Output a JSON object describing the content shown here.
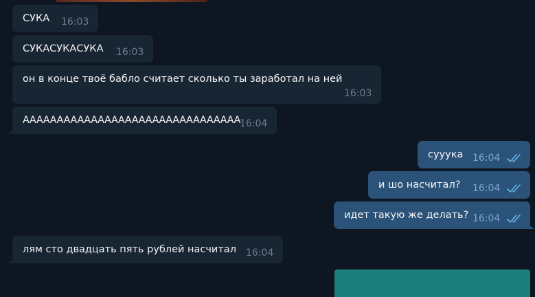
{
  "chat": {
    "messages": [
      {
        "text": "СУКА",
        "time": "16:03"
      },
      {
        "text": "СУКАСУКАСУКА",
        "time": "16:03"
      },
      {
        "text": "он в конце твоё бабло считает сколько ты заработал на ней",
        "time": "16:03"
      },
      {
        "text": "АААААААААААААААААААААААААААААААА",
        "time": "16:04"
      },
      {
        "text": "сууука",
        "time": "16:04"
      },
      {
        "text": "и шо насчитал?",
        "time": "16:04"
      },
      {
        "text": "идет такую же делать?",
        "time": "16:04"
      },
      {
        "text": "лям сто двадцать пять рублей насчитал",
        "time": "16:04"
      }
    ]
  },
  "colors": {
    "background": "#0e1621",
    "incoming_bubble": "#182533",
    "outgoing_bubble": "#2b5278",
    "read_check": "#64b5ef",
    "media_preview": "#1d7f7b"
  },
  "icons": {
    "read_receipt": "double-check-icon"
  }
}
